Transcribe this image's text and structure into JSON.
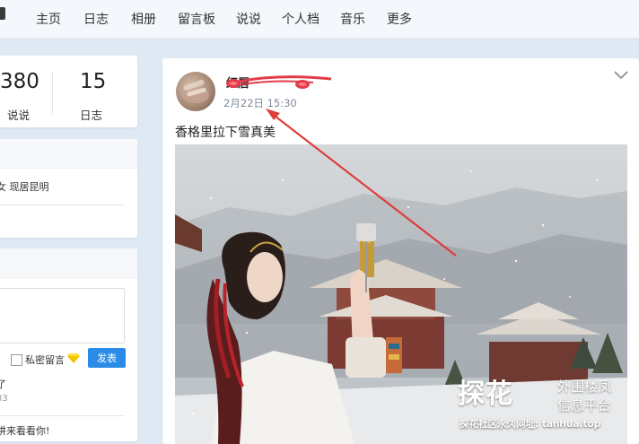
{
  "nav": {
    "items": [
      "主页",
      "日志",
      "相册",
      "留言板",
      "说说",
      "个人档",
      "音乐",
      "更多"
    ]
  },
  "stats": {
    "shuoshuo_count": "380",
    "shuoshuo_label": "说说",
    "rizhi_count": "15",
    "rizhi_label": "日志"
  },
  "profile": {
    "info": "女 现居昆明"
  },
  "guestbook": {
    "private_label": "私密留言",
    "post_label": "发表",
    "entries": [
      {
        "text": "了",
        "time": "33"
      },
      {
        "text": "讲来看看你!"
      }
    ]
  },
  "post": {
    "author": "红唇",
    "time": "2月22日 15:30",
    "text": "香格里拉下雪真美",
    "icons": {
      "menu": "chevron-down-icon",
      "avatar": "avatar"
    }
  },
  "watermark": {
    "brand": "探花",
    "line1": "外围楼凤",
    "line2": "信息平台",
    "url": "探花社区永久网址: tanhua.top"
  },
  "colors": {
    "accent": "#2b8ce8",
    "annotation": "#e03c3c",
    "page_bg": "#dfe9f3"
  }
}
